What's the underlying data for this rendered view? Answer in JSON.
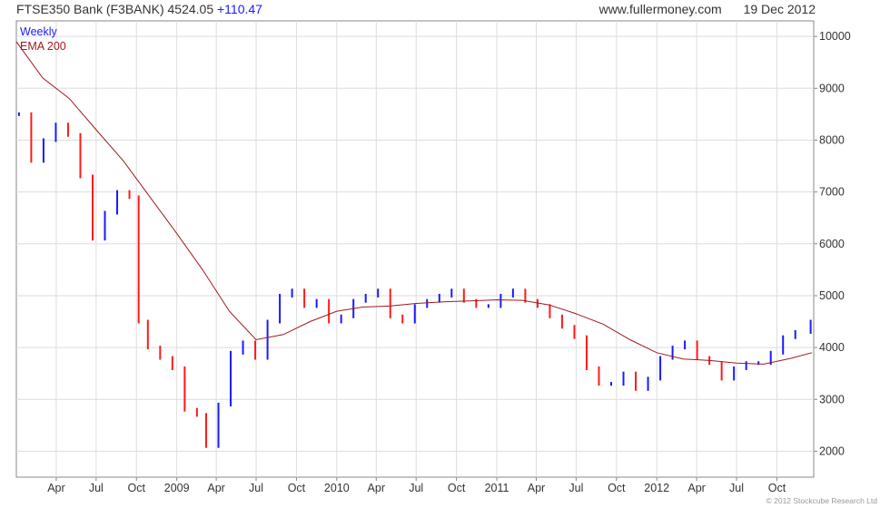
{
  "header": {
    "title": "FTSE350 Bank (F3BANK) 4524.05",
    "change": "+110.47",
    "site": "www.fullermoney.com",
    "date": "19 Dec 2012"
  },
  "footer": {
    "copyright": "© 2012 Stockcube Research Ltd"
  },
  "colors": {
    "up": "#1a1aff",
    "down": "#ff1a1a",
    "ema": "#a0191e",
    "grid": "#dddddd"
  },
  "chart_data": {
    "type": "line",
    "title": "FTSE350 Bank (F3BANK) 4524.05 +110.47",
    "legend": [
      {
        "name": "Weekly",
        "color": "#1a1aff"
      },
      {
        "name": "EMA 200",
        "color": "#a0191e"
      }
    ],
    "legend_position": "top-left",
    "grid": true,
    "ylim": [
      1500,
      10300
    ],
    "yticks": [
      2000,
      3000,
      4000,
      5000,
      6000,
      7000,
      8000,
      9000,
      10000
    ],
    "xlim": [
      "2008-01-01",
      "2012-12-24"
    ],
    "xticks": [
      {
        "label": "Apr",
        "date": "2008-04-01"
      },
      {
        "label": "Jul",
        "date": "2008-07-01"
      },
      {
        "label": "Oct",
        "date": "2008-10-01"
      },
      {
        "label": "2009",
        "date": "2009-01-01"
      },
      {
        "label": "Apr",
        "date": "2009-04-01"
      },
      {
        "label": "Jul",
        "date": "2009-07-01"
      },
      {
        "label": "Oct",
        "date": "2009-10-01"
      },
      {
        "label": "2010",
        "date": "2010-01-01"
      },
      {
        "label": "Apr",
        "date": "2010-04-01"
      },
      {
        "label": "Jul",
        "date": "2010-07-01"
      },
      {
        "label": "Oct",
        "date": "2010-10-01"
      },
      {
        "label": "2011",
        "date": "2011-01-01"
      },
      {
        "label": "Apr",
        "date": "2011-04-01"
      },
      {
        "label": "Jul",
        "date": "2011-07-01"
      },
      {
        "label": "Oct",
        "date": "2011-10-01"
      },
      {
        "label": "2012",
        "date": "2012-01-01"
      },
      {
        "label": "Apr",
        "date": "2012-04-01"
      },
      {
        "label": "Jul",
        "date": "2012-07-01"
      },
      {
        "label": "Oct",
        "date": "2012-10-01"
      }
    ],
    "series": [
      {
        "name": "Weekly",
        "type": "weekly-bars",
        "x": [
          "2008-01-07",
          "2008-02-04",
          "2008-03-03",
          "2008-03-31",
          "2008-04-28",
          "2008-05-26",
          "2008-06-23",
          "2008-07-21",
          "2008-08-18",
          "2008-09-15",
          "2008-10-06",
          "2008-10-27",
          "2008-11-24",
          "2008-12-22",
          "2009-01-19",
          "2009-02-16",
          "2009-03-09",
          "2009-04-06",
          "2009-05-04",
          "2009-06-01",
          "2009-06-29",
          "2009-07-27",
          "2009-08-24",
          "2009-09-21",
          "2009-10-19",
          "2009-11-16",
          "2009-12-14",
          "2010-01-11",
          "2010-02-08",
          "2010-03-08",
          "2010-04-05",
          "2010-05-03",
          "2010-05-31",
          "2010-06-28",
          "2010-07-26",
          "2010-08-23",
          "2010-09-20",
          "2010-10-18",
          "2010-11-15",
          "2010-12-13",
          "2011-01-10",
          "2011-02-07",
          "2011-03-07",
          "2011-04-04",
          "2011-05-02",
          "2011-05-30",
          "2011-06-27",
          "2011-07-25",
          "2011-08-22",
          "2011-09-19",
          "2011-10-17",
          "2011-11-14",
          "2011-12-12",
          "2012-01-09",
          "2012-02-06",
          "2012-03-05",
          "2012-04-02",
          "2012-04-30",
          "2012-05-28",
          "2012-06-25",
          "2012-07-23",
          "2012-08-20",
          "2012-09-17",
          "2012-10-15",
          "2012-11-12",
          "2012-12-17"
        ],
        "y": [
          8500,
          7600,
          8000,
          8300,
          8100,
          7300,
          6100,
          6600,
          7000,
          6900,
          4500,
          4000,
          3800,
          3600,
          2800,
          2700,
          2100,
          2900,
          3900,
          4100,
          3800,
          4500,
          5000,
          5100,
          4800,
          4900,
          4500,
          4600,
          4900,
          5000,
          5100,
          4600,
          4500,
          4800,
          4900,
          5000,
          5100,
          4900,
          4800,
          4800,
          5000,
          5100,
          4900,
          4800,
          4600,
          4400,
          4200,
          3600,
          3300,
          3300,
          3500,
          3200,
          3400,
          3800,
          4000,
          4100,
          3800,
          3700,
          3400,
          3600,
          3700,
          3700,
          3900,
          4200,
          4300,
          4500
        ]
      },
      {
        "name": "EMA 200",
        "type": "line",
        "x": [
          "2008-01-01",
          "2008-03-01",
          "2008-05-01",
          "2008-07-01",
          "2008-09-01",
          "2008-11-01",
          "2009-01-01",
          "2009-03-01",
          "2009-05-01",
          "2009-07-01",
          "2009-09-01",
          "2009-11-01",
          "2010-01-01",
          "2010-03-01",
          "2010-05-01",
          "2010-07-01",
          "2010-09-01",
          "2010-11-01",
          "2011-01-01",
          "2011-03-01",
          "2011-05-01",
          "2011-07-01",
          "2011-09-01",
          "2011-11-01",
          "2012-01-01",
          "2012-03-01",
          "2012-05-01",
          "2012-07-01",
          "2012-09-01",
          "2012-11-01",
          "2012-12-20"
        ],
        "y": [
          9900,
          9200,
          8800,
          8200,
          7600,
          6900,
          6200,
          5500,
          4700,
          4150,
          4250,
          4500,
          4700,
          4780,
          4800,
          4850,
          4880,
          4900,
          4920,
          4910,
          4820,
          4650,
          4450,
          4150,
          3900,
          3780,
          3750,
          3700,
          3680,
          3790,
          3900
        ]
      }
    ]
  }
}
